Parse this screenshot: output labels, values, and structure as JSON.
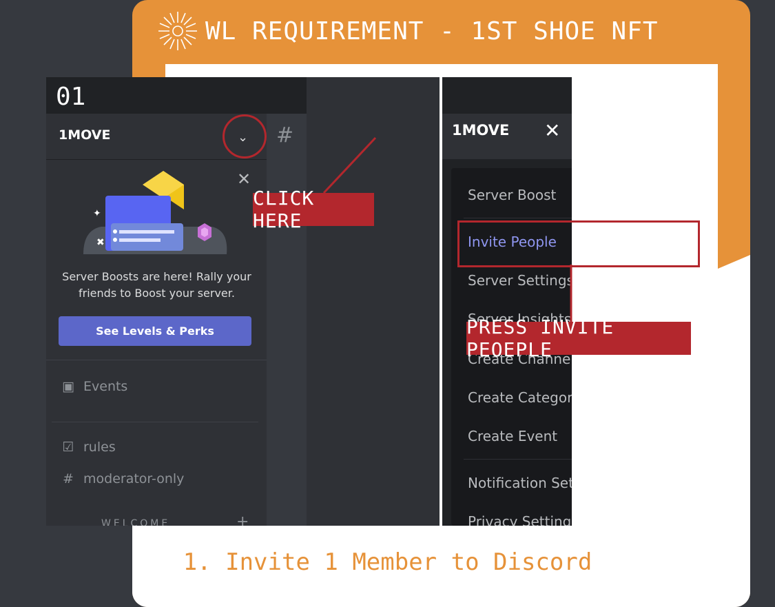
{
  "card": {
    "title": "WL REQUIREMENT - 1ST SHOE NFT",
    "caption": "1. Invite 1 Member to Discord",
    "accent_color": "#e69239"
  },
  "step": {
    "number": "01"
  },
  "left_panel": {
    "server_name": "1MOVE",
    "boost_text_line1": "Server Boosts are here! Rally your",
    "boost_text_line2": "friends to Boost your server.",
    "levels_button": "See Levels & Perks",
    "events": "Events",
    "channels": [
      {
        "label": "rules",
        "icon": "checkbox-icon"
      },
      {
        "label": "moderator-only",
        "icon": "hash-lock-icon"
      }
    ],
    "category": "WELCOME"
  },
  "right_panel": {
    "server_name": "1MOVE",
    "menu_items": [
      {
        "label": "Server Boost",
        "icon": "boost-gem-icon"
      },
      {
        "label": "Invite People",
        "icon": "add-person-icon"
      },
      {
        "label": "Server Settings",
        "icon": "gear-icon"
      },
      {
        "label": "Server Insights",
        "icon": "insights-icon"
      },
      {
        "label": "Create Channel",
        "icon": "plus-circle-icon"
      },
      {
        "label": "Create Category",
        "icon": "folder-plus-icon"
      },
      {
        "label": "Create Event",
        "icon": "calendar-plus-icon"
      },
      {
        "label": "Notification Settings",
        "icon": "bell-icon"
      },
      {
        "label": "Privacy Settings",
        "icon": "shield-icon"
      }
    ]
  },
  "annotations": {
    "click_here": "CLICK HERE",
    "press_invite": "PRESS INVITE PEOEPLE",
    "highlight_color": "#b3272d"
  }
}
